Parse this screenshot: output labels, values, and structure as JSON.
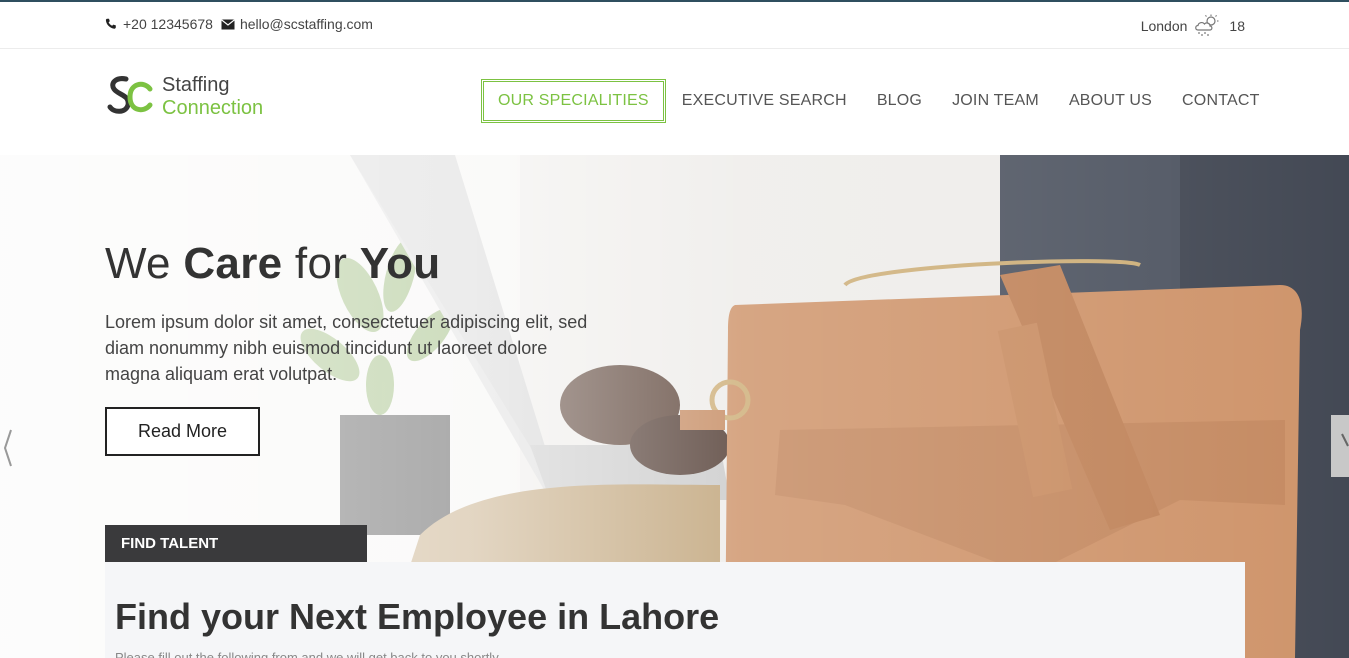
{
  "topbar": {
    "phone": "+20 12345678",
    "email": "hello@scstaffing.com",
    "city": "London",
    "temp": "18"
  },
  "brand": {
    "line1": "Staffing",
    "line2": "Connection",
    "accent": "#7cc242"
  },
  "nav": {
    "items": [
      {
        "label": "OUR SPECIALITIES"
      },
      {
        "label": "EXECUTIVE SEARCH"
      },
      {
        "label": "BLOG"
      },
      {
        "label": "JOIN TEAM"
      },
      {
        "label": "ABOUT US"
      },
      {
        "label": "CONTACT"
      }
    ]
  },
  "hero": {
    "title_a": "We ",
    "title_b": "Care",
    "title_c": " for ",
    "title_d": "You",
    "text": "Lorem ipsum dolor sit amet, consectetuer adipiscing elit, sed diam nonummy nibh euismod tincidunt ut laoreet dolore magna aliquam erat volutpat.",
    "button": "Read More"
  },
  "find": {
    "tab": "FIND TALENT",
    "title": "Find your Next Employee in Lahore",
    "subtitle": "Please fill out the following from and we will get back to you shortly"
  }
}
